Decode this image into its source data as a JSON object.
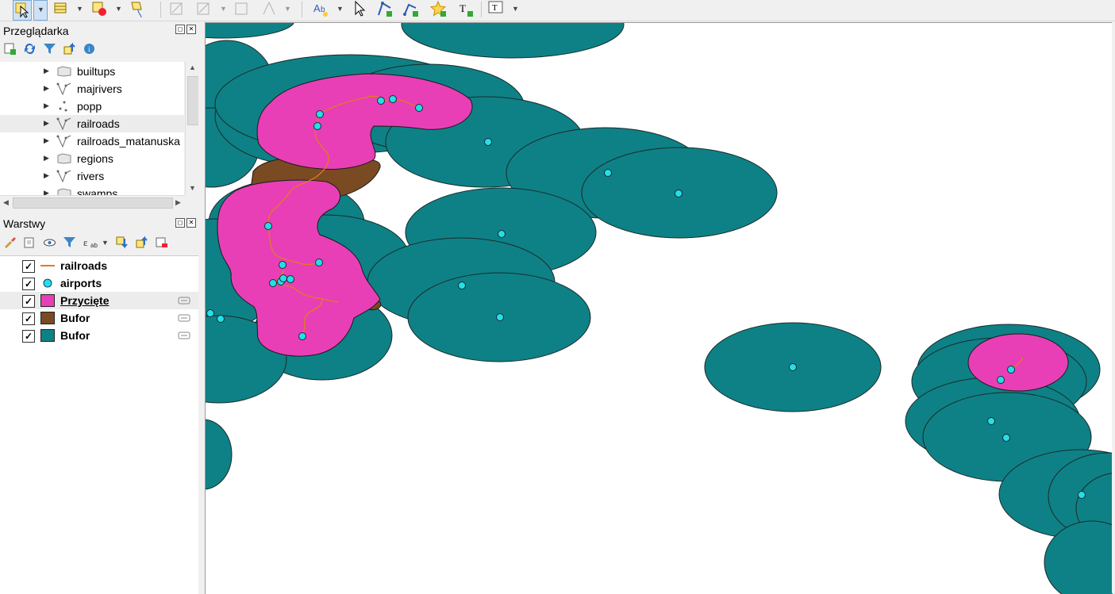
{
  "toolbar": {
    "icons": [
      "select-features-icon",
      "attribute-table-icon",
      "remove-selection-icon",
      "deselect-icon",
      "digitize-icon",
      "edit-icon",
      "node-tool-icon",
      "vertex-icon",
      "label-icon",
      "pan-icon",
      "add-line-icon",
      "add-node-icon",
      "star-icon",
      "text-annotation-icon",
      "text-icon"
    ]
  },
  "browser": {
    "title": "Przeglądarka",
    "items": [
      {
        "label": "builtups",
        "icon": "polygon-layer-icon"
      },
      {
        "label": "majrivers",
        "icon": "line-layer-icon"
      },
      {
        "label": "popp",
        "icon": "point-layer-icon"
      },
      {
        "label": "railroads",
        "icon": "line-layer-icon"
      },
      {
        "label": "railroads_matanuska",
        "icon": "line-layer-icon"
      },
      {
        "label": "regions",
        "icon": "polygon-layer-icon"
      },
      {
        "label": "rivers",
        "icon": "line-layer-icon"
      },
      {
        "label": "swamps",
        "icon": "polygon-layer-icon"
      }
    ]
  },
  "layers": {
    "title": "Warstwy",
    "items": [
      {
        "label": "railroads",
        "color": "#e07b20",
        "type": "line",
        "checked": "✓"
      },
      {
        "label": "airports",
        "color": "#22e0e6",
        "type": "point",
        "checked": "✓"
      },
      {
        "label": "Przycięte",
        "color": "#e83fb6",
        "type": "polygon",
        "checked": "✓"
      },
      {
        "label": "Bufor",
        "color": "#7a4a22",
        "type": "polygon",
        "checked": "✓"
      },
      {
        "label": "Bufor",
        "color": "#0e8186",
        "type": "polygon",
        "checked": "✓"
      }
    ]
  },
  "colors": {
    "teal": "#0e8186",
    "pink": "#e83fb6",
    "brown": "#7a4a22",
    "airport": "#22e0e6",
    "railroad": "#e07b20"
  }
}
